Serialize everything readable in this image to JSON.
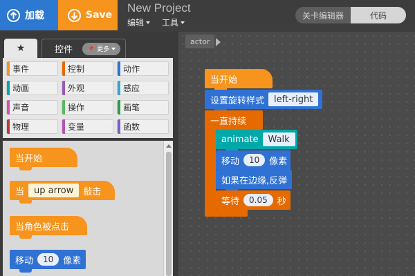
{
  "topbar": {
    "load_label": "加载",
    "save_label": "Save",
    "project_title": "New Project",
    "menu_edit": "编辑",
    "menu_tools": "工具",
    "toggle_level_editor": "关卡编辑器",
    "toggle_code": "代码"
  },
  "palette_tabs": {
    "favorites_symbol": "★",
    "controls_label": "控件",
    "more_label": "更多"
  },
  "categories": [
    {
      "label": "事件",
      "color": "#f7941d"
    },
    {
      "label": "控制",
      "color": "#e66a00"
    },
    {
      "label": "动作",
      "color": "#3072d3"
    },
    {
      "label": "动画",
      "color": "#00a8a8"
    },
    {
      "label": "外观",
      "color": "#9b59b6"
    },
    {
      "label": "感应",
      "color": "#3aa6c9"
    },
    {
      "label": "声音",
      "color": "#d651b0"
    },
    {
      "label": "操作",
      "color": "#5cb85c"
    },
    {
      "label": "画笔",
      "color": "#2e9c4a"
    },
    {
      "label": "物理",
      "color": "#c0392b"
    },
    {
      "label": "变量",
      "color": "#b356b3"
    },
    {
      "label": "函数",
      "color": "#7a5fc4"
    }
  ],
  "palette_blocks": {
    "when_run": "当开始",
    "key_prefix": "当",
    "key_value": "up arrow",
    "key_suffix": "敲击",
    "actor_clicked": "当角色被点击",
    "move_label": "移动",
    "move_value": "10",
    "move_unit": "像素"
  },
  "workspace": {
    "actor_tab": "actor",
    "when_run": "当开始",
    "set_rotation_label": "设置旋转样式",
    "set_rotation_value": "left-right",
    "forever_label": "一直持续",
    "animate_label": "animate",
    "animate_value": "Walk",
    "move_label": "移动",
    "move_value": "10",
    "move_unit": "像素",
    "bounce_label": "如果在边缘,反弹",
    "wait_label": "等待",
    "wait_value": "0.05",
    "wait_unit": "秒"
  }
}
